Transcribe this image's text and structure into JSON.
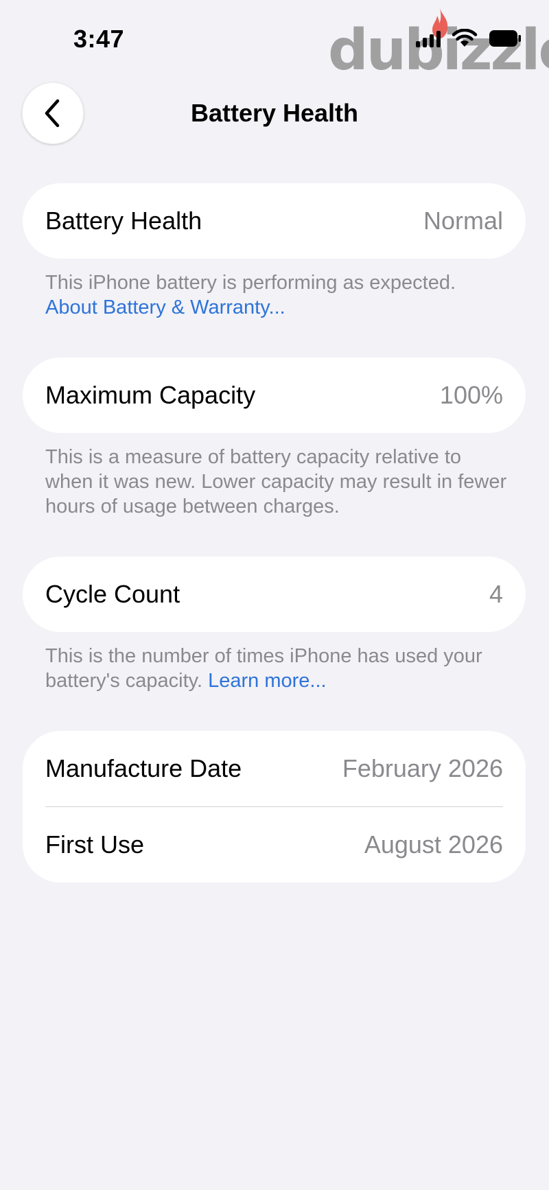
{
  "status_bar": {
    "time": "3:47",
    "icons": [
      "signal-icon",
      "wifi-icon",
      "battery-icon"
    ]
  },
  "watermark": {
    "text": "dubizzle",
    "color": "#808080",
    "flame_color": "#E8473D"
  },
  "nav": {
    "title": "Battery Health",
    "back_icon": "chevron-left-icon"
  },
  "sections": {
    "health": {
      "label": "Battery Health",
      "value": "Normal",
      "note": "This iPhone battery is performing as expected.",
      "link": "About Battery & Warranty..."
    },
    "capacity": {
      "label": "Maximum Capacity",
      "value": "100%",
      "note": "This is a measure of battery capacity relative to when it was new. Lower capacity may result in fewer hours of usage between charges."
    },
    "cycle": {
      "label": "Cycle Count",
      "value": "4",
      "note": "This is the number of times iPhone has used your battery's capacity.",
      "link": "Learn more..."
    },
    "dates": {
      "manufacture_label": "Manufacture Date",
      "manufacture_value": "February 2026",
      "first_use_label": "First Use",
      "first_use_value": "August 2026"
    }
  },
  "colors": {
    "background": "#F2F2F7",
    "card": "#FFFFFF",
    "secondary_text": "#8A8A8E",
    "link": "#2E73D9"
  }
}
